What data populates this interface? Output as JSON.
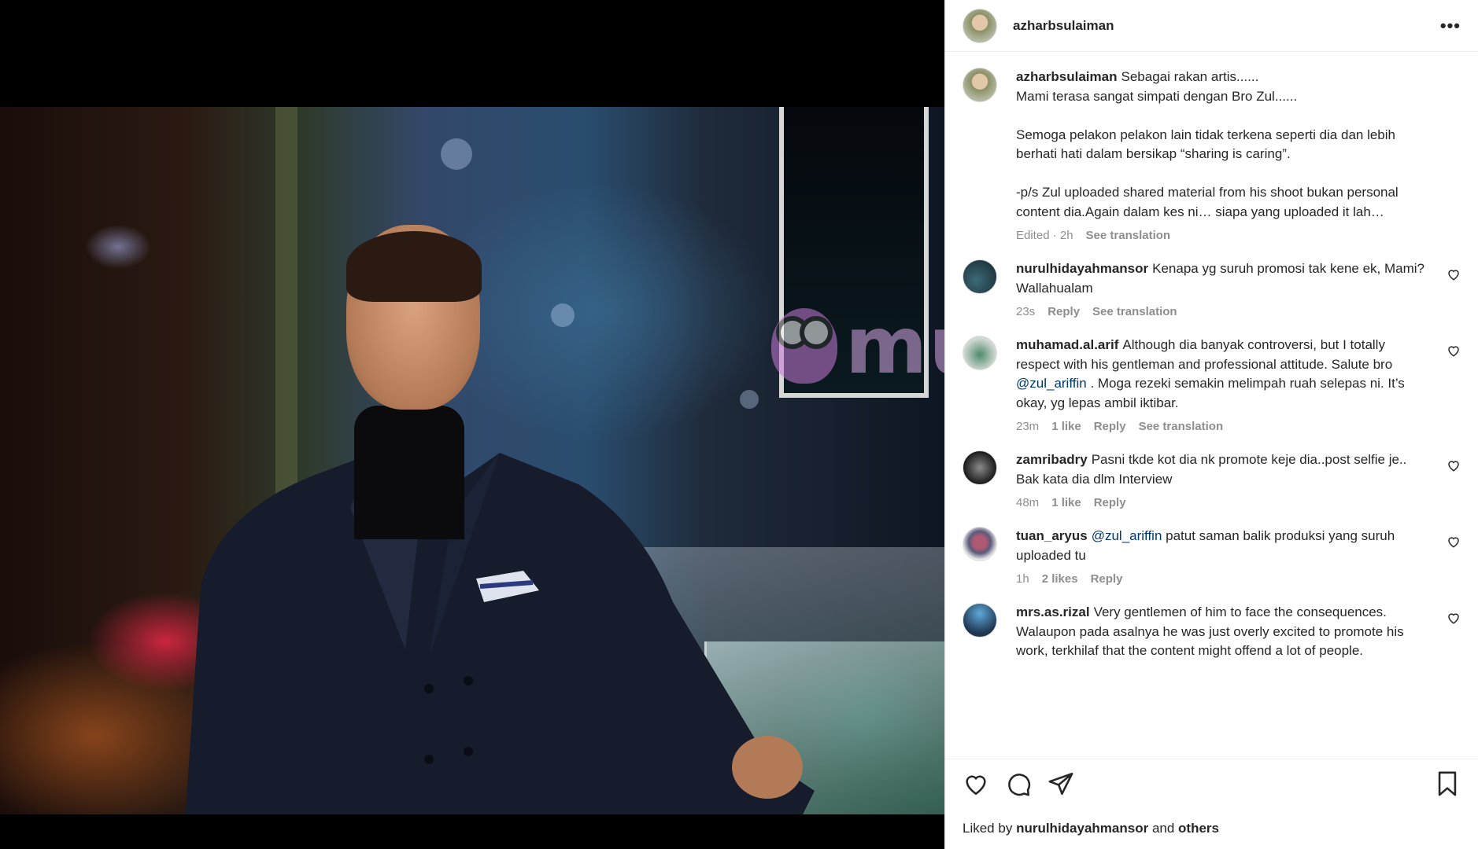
{
  "post": {
    "author": "azharbsulaiman",
    "more_label": "•••",
    "watermark": "murai"
  },
  "caption": {
    "username": "azharbsulaiman",
    "lines": [
      "Sebagai rakan artis......",
      "Mami terasa sangat simpati dengan Bro Zul......",
      "",
      "Semoga pelakon pelakon lain tidak terkena seperti dia dan lebih",
      "berhati hati dalam bersikap “sharing is caring”.",
      "",
      "-p/s Zul uploaded shared material from his shoot bukan personal",
      "content dia.Again dalam kes ni… siapa yang uploaded it lah…"
    ],
    "edited": "Edited · 2h",
    "see_translation": "See translation"
  },
  "comments": [
    {
      "username": "nurulhidayahmansor",
      "text": "Kenapa yg suruh promosi tak kene ek, Mami? Wallahualam",
      "time": "23s",
      "likes": "",
      "reply": "Reply",
      "translate": "See translation"
    },
    {
      "username": "muhamad.al.arif",
      "text_before": "Although dia banyak controversi, but I totally respect with his gentleman and professional attitude. Salute bro ",
      "mention": "@zul_ariffin",
      "text_after": " . Moga rezeki semakin melimpah ruah selepas ni. It’s okay, yg lepas ambil iktibar.",
      "time": "23m",
      "likes": "1 like",
      "reply": "Reply",
      "translate": "See translation"
    },
    {
      "username": "zamribadry",
      "text": "Pasni tkde kot dia nk promote keje dia..post selfie je.. Bak kata dia dlm Interview",
      "time": "48m",
      "likes": "1 like",
      "reply": "Reply",
      "translate": ""
    },
    {
      "username": "tuan_aryus",
      "mention": "@zul_ariffin",
      "text_after": " patut saman balik produksi yang suruh uploaded tu",
      "time": "1h",
      "likes": "2 likes",
      "reply": "Reply",
      "translate": ""
    },
    {
      "username": "mrs.as.rizal",
      "text": "Very gentlemen of him to face the consequences. Walaupon pada asalnya he was just overly excited to promote his work, terkhilaf that the content might offend a lot of people.",
      "time": "",
      "likes": "",
      "reply": "",
      "translate": ""
    }
  ],
  "liked_by": {
    "prefix": "Liked by",
    "user": "nurulhidayahmansor",
    "and": "and",
    "others": "others"
  },
  "icons": {
    "like": "heart-icon",
    "comment": "comment-icon",
    "share": "share-icon",
    "save": "bookmark-icon",
    "more": "more-icon"
  },
  "colors": {
    "mention": "#00376b",
    "meta": "#8e8e8e",
    "text": "#262626",
    "border": "#dbdbdb"
  }
}
